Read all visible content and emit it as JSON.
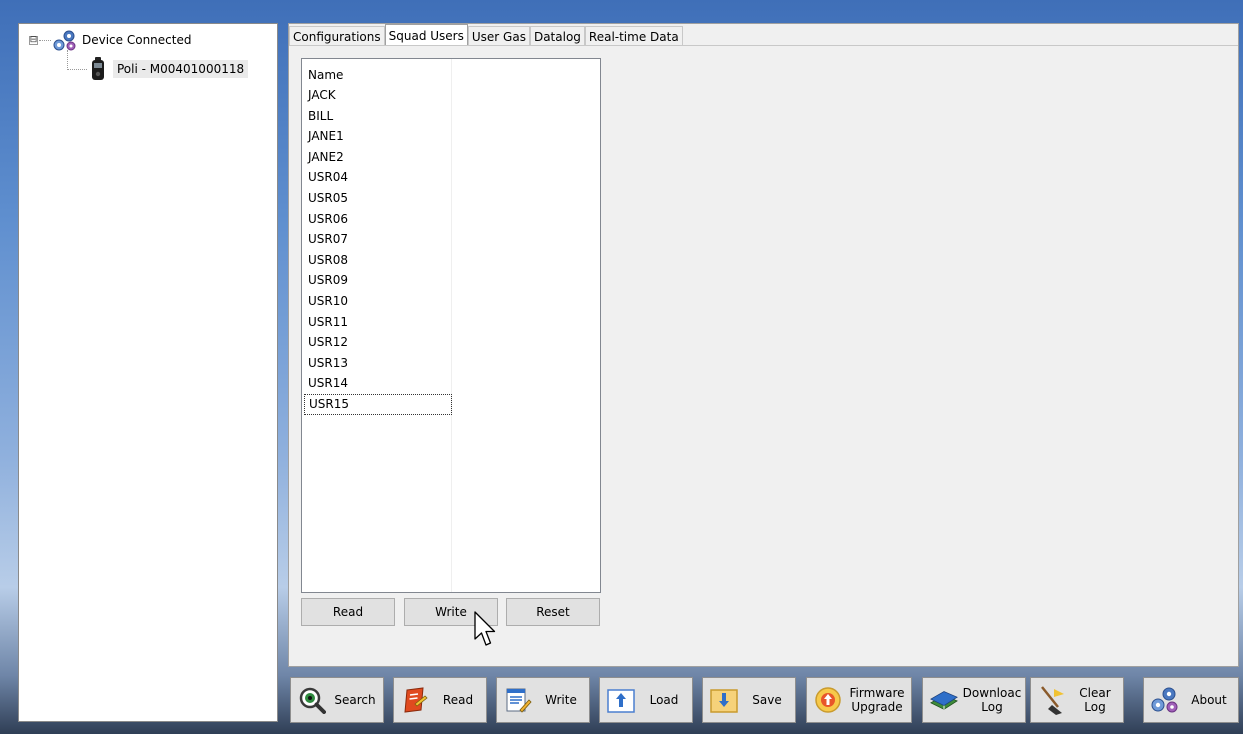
{
  "tree": {
    "root_label": "Device Connected",
    "expander": "⊟",
    "child_label": "Poli - M00401000118"
  },
  "tabs": [
    {
      "label": "Configurations",
      "active": false
    },
    {
      "label": "Squad Users",
      "active": true
    },
    {
      "label": "User Gas",
      "active": false
    },
    {
      "label": "Datalog",
      "active": false
    },
    {
      "label": "Real-time Data",
      "active": false
    }
  ],
  "squad_users": {
    "header": "Name",
    "users": [
      "JACK",
      "BILL",
      "JANE1",
      "JANE2",
      "USR04",
      "USR05",
      "USR06",
      "USR07",
      "USR08",
      "USR09",
      "USR10",
      "USR11",
      "USR12",
      "USR13",
      "USR14",
      "USR15"
    ],
    "focused_user": "USR15",
    "read_label": "Read",
    "write_label": "Write",
    "reset_label": "Reset"
  },
  "toolbar": {
    "search": "Search",
    "read": "Read",
    "write": "Write",
    "load": "Load",
    "save": "Save",
    "firmware_line1": "Firmware",
    "firmware_line2": "Upgrade",
    "download_line1": "Downloac",
    "download_line2": "Log",
    "clear_line1": "Clear",
    "clear_line2": "Log",
    "about": "About"
  },
  "icons": {
    "root": "gears-icon",
    "device": "gas-detector-icon",
    "search": "magnifier-eye-icon",
    "read": "red-book-icon",
    "write": "document-pen-icon",
    "load": "upload-arrow-icon",
    "save": "download-arrow-icon",
    "firmware": "firmware-upgrade-icon",
    "download_log": "book-stack-icon",
    "clear_log": "broom-icon",
    "about": "gears-icon"
  }
}
